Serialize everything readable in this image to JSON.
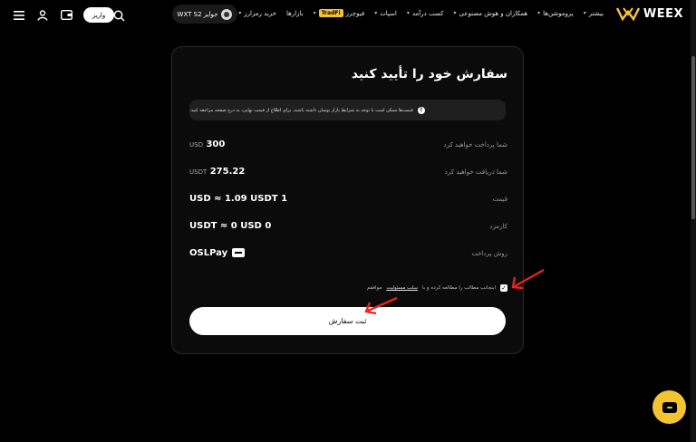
{
  "nav": {
    "logo_text": "WEEX",
    "menu": [
      {
        "label": "خرید رمزارز",
        "chevron": true,
        "tag": ""
      },
      {
        "label": "بازارها",
        "chevron": false,
        "tag": ""
      },
      {
        "label": "فیوچرز",
        "chevron": true,
        "tag": "TradFi"
      },
      {
        "label": "اسپات",
        "chevron": true,
        "tag": ""
      },
      {
        "label": "کسب درآمد",
        "chevron": true,
        "tag": ""
      },
      {
        "label": "همکاران و هوش مصنوعی",
        "chevron": true,
        "tag": ""
      },
      {
        "label": "پروموشن‌ها",
        "chevron": true,
        "tag": ""
      },
      {
        "label": "بیشتر",
        "chevron": true,
        "tag": ""
      }
    ],
    "promo_label": "جوایز WXT S2",
    "deposit_label": "واریز"
  },
  "card": {
    "title": "سفارش خود را تأیید کنید",
    "notice": "قیمت‌ها ممکن است با توجه به شرایط بازار نوسان داشته باشند. برای اطلاع از قیمت نهایی، به درج صفحه مراجعه کنید.",
    "rows": [
      {
        "label": "شما پرداخت خواهید کرد",
        "value": "300",
        "unit": "USD"
      },
      {
        "label": "شما دریافت خواهید کرد",
        "value": "275.22",
        "unit": "USDT"
      },
      {
        "label": "قیمت",
        "value": "1 USD ≈ 1.09 USDT",
        "unit": ""
      },
      {
        "label": "کارمزد",
        "value": "0 USDT ≈ 0 USD",
        "unit": ""
      },
      {
        "label": "روش پرداخت",
        "value": "OSLPay",
        "unit": ""
      }
    ],
    "agree_prefix": "اینجانب مطالب را مطالعه کرده و با",
    "agree_link": "سلب مسئولیت",
    "agree_suffix": "موافقم",
    "agree_checked": true,
    "submit_label": "ثبت سفارش"
  },
  "colors": {
    "accent": "#f4c430",
    "arrow": "#e8231e"
  }
}
